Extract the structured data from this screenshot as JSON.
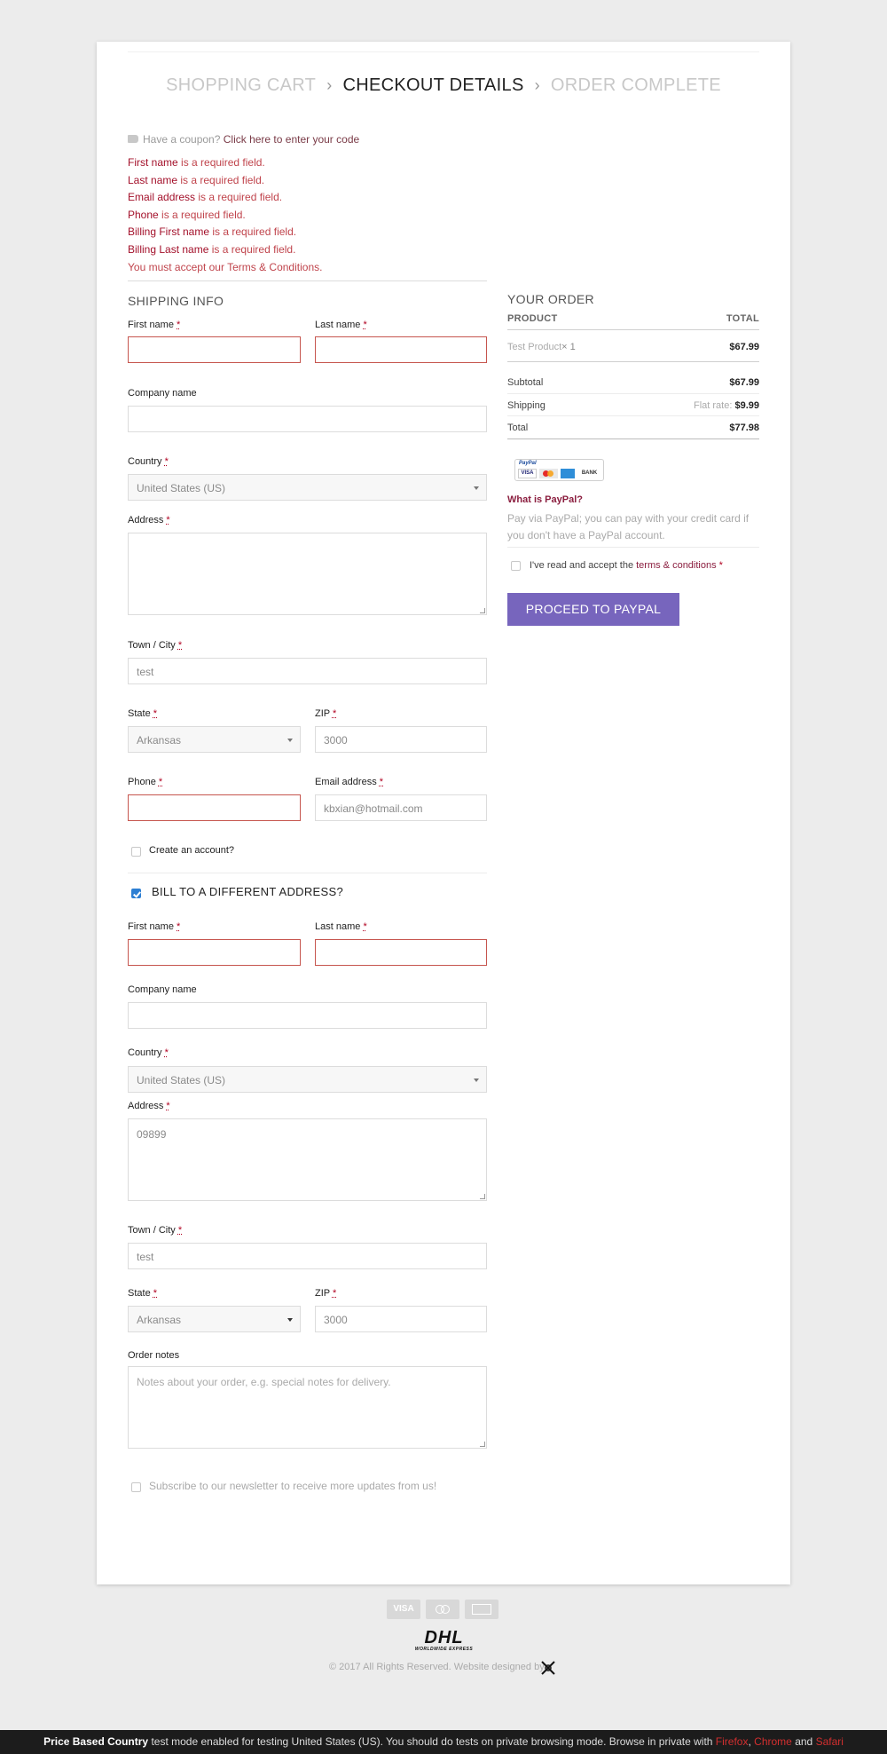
{
  "steps": {
    "step1": "SHOPPING CART",
    "step2": "CHECKOUT DETAILS",
    "step3": "ORDER COMPLETE"
  },
  "coupon": {
    "prompt": "Have a coupon?",
    "link": "Click here to enter your code"
  },
  "errors": [
    {
      "field": "First name",
      "msg": " is a required field."
    },
    {
      "field": "Last name",
      "msg": " is a required field."
    },
    {
      "field": "Email address",
      "msg": " is a required field."
    },
    {
      "field": "Phone",
      "msg": " is a required field."
    },
    {
      "field": "Billing First name",
      "msg": " is a required field."
    },
    {
      "field": "Billing Last name",
      "msg": " is a required field."
    },
    {
      "field": "",
      "msg": "You must accept our Terms & Conditions."
    }
  ],
  "shipping": {
    "title": "SHIPPING INFO",
    "first_name_label": "First name",
    "last_name_label": "Last name",
    "company_label": "Company name",
    "country_label": "Country",
    "country_value": "United States (US)",
    "address_label": "Address",
    "town_label": "Town / City",
    "town_value": "test",
    "state_label": "State",
    "state_value": "Arkansas",
    "zip_label": "ZIP",
    "zip_value": "3000",
    "phone_label": "Phone",
    "email_label": "Email address",
    "email_value": "kbxian@hotmail.com",
    "create_account": "Create an account?"
  },
  "billing": {
    "toggle_label": "BILL TO A DIFFERENT ADDRESS?",
    "first_name_label": "First name",
    "last_name_label": "Last name",
    "company_label": "Company name",
    "country_label": "Country",
    "country_value": "United States (US)",
    "address_label": "Address",
    "address_value": "09899",
    "town_label": "Town / City",
    "town_value": "test",
    "state_label": "State",
    "state_value": "Arkansas",
    "zip_label": "ZIP",
    "zip_value": "3000",
    "notes_label": "Order notes",
    "notes_placeholder": "Notes about your order, e.g. special notes for delivery.",
    "newsletter": "Subscribe to our newsletter to receive more updates from us!"
  },
  "order": {
    "title": "YOUR ORDER",
    "col_product": "PRODUCT",
    "col_total": "TOTAL",
    "product_name": "Test Product",
    "product_qty": "× 1",
    "product_total": "$67.99",
    "subtotal_label": "Subtotal",
    "subtotal_value": "$67.99",
    "shipping_label": "Shipping",
    "shipping_method": "Flat rate:",
    "shipping_value": "$9.99",
    "total_label": "Total",
    "total_value": "$77.98",
    "paypal_badge": "PayPal",
    "badge_visa": "VISA",
    "badge_bank": "BANK",
    "what_is_paypal": "What is PayPal?",
    "paypal_desc": "Pay via PayPal; you can pay with your credit card if you don't have a PayPal account.",
    "terms_prefix": "I've read and accept the ",
    "terms_link": "terms & conditions",
    "terms_req": " *",
    "button": "PROCEED TO PAYPAL"
  },
  "footer": {
    "card_visa": "VISA",
    "dhl": "DHL",
    "dhl_sub": "WORLDWIDE EXPRESS",
    "copyright": "© 2017 All Rights Reserved. Website designed by",
    "bar_bold": "Price Based Country",
    "bar_text": " test mode enabled for testing United States (US). You should do tests on private browsing mode. Browse in private with ",
    "bar_firefox": "Firefox",
    "bar_chrome": "Chrome",
    "bar_and": "and",
    "bar_safari": "Safari"
  },
  "colors": {
    "accent": "#7765bd",
    "error": "#c0444c",
    "link": "#7a3b47"
  }
}
